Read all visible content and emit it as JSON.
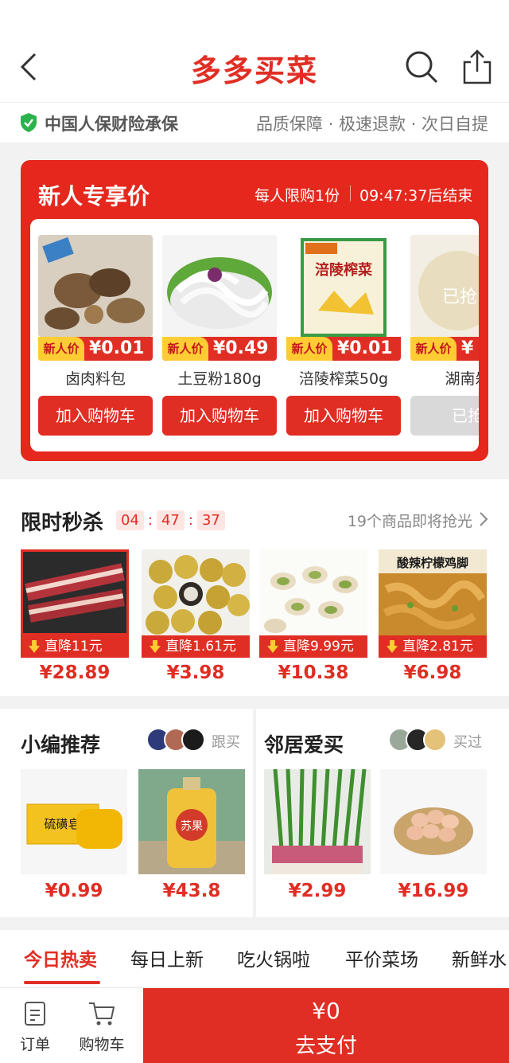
{
  "header": {
    "title": "多多买菜"
  },
  "guarantee": {
    "insurer": "中国人保财险承保",
    "promises": "品质保障 · 极速退款 · 次日自提"
  },
  "new_user": {
    "title": "新人专享价",
    "limit": "每人限购1份",
    "timer": "09:47:37后结束",
    "tag_label": "新人价",
    "items": [
      {
        "name": "卤肉料包",
        "price": "¥0.01",
        "button": "加入购物车"
      },
      {
        "name": "土豆粉180g",
        "price": "¥0.49",
        "button": "加入购物车"
      },
      {
        "name": "涪陵榨菜50g",
        "price": "¥0.01",
        "button": "加入购物车",
        "package_text": "涪陵榨菜"
      },
      {
        "name": "湖南剁",
        "price": "¥",
        "button": "已抢",
        "sold_text": "已抢"
      }
    ]
  },
  "flash_sale": {
    "title": "限时秒杀",
    "countdown": {
      "h": "04",
      "m": "47",
      "s": "37"
    },
    "more": "19个商品即将抢光",
    "items": [
      {
        "drop": "直降11元",
        "price": "¥28.89"
      },
      {
        "drop": "直降1.61元",
        "price": "¥3.98"
      },
      {
        "drop": "直降9.99元",
        "price": "¥10.38"
      },
      {
        "drop": "直降2.81元",
        "price": "¥6.98",
        "image_text": "酸辣柠檬鸡脚"
      }
    ]
  },
  "editor_picks": {
    "title": "小编推荐",
    "social": "跟买",
    "items": [
      {
        "price": "¥0.99",
        "image_text": "硫磺皂"
      },
      {
        "price": "¥43.8",
        "image_text": "苏果"
      }
    ]
  },
  "neighbors": {
    "title": "邻居爱买",
    "social": "买过",
    "items": [
      {
        "price": "¥2.99"
      },
      {
        "price": "¥16.99"
      }
    ]
  },
  "category_tabs": [
    "今日热卖",
    "每日上新",
    "吃火锅啦",
    "平价菜场",
    "新鲜水"
  ],
  "bottom_bar": {
    "orders": "订单",
    "cart": "购物车",
    "amount": "¥0",
    "pay": "去支付"
  },
  "colors": {
    "accent": "#e02e24",
    "tag_yellow": "#ffcc33",
    "shield_green": "#2bb24c"
  },
  "icons": [
    "back-icon",
    "search-icon",
    "share-icon",
    "shield-icon",
    "chevron-right-icon",
    "down-arrow-icon",
    "order-icon",
    "cart-icon"
  ]
}
